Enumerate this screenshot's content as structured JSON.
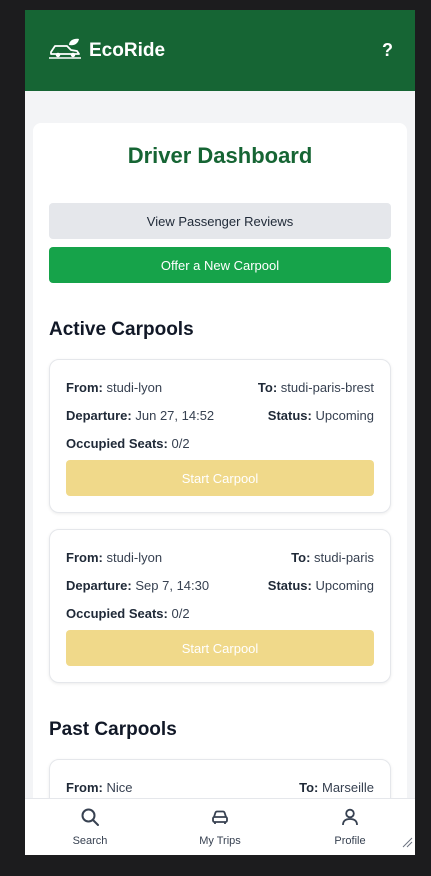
{
  "header": {
    "brand": "EcoRide",
    "help": "?"
  },
  "main": {
    "title": "Driver Dashboard",
    "reviews_label": "View Passenger Reviews",
    "offer_label": "Offer a New Carpool"
  },
  "active": {
    "title": "Active Carpools",
    "trips": [
      {
        "from_label": "From:",
        "from": "studi-lyon",
        "to_label": "To:",
        "to": "studi-paris-brest",
        "departure_label": "Departure:",
        "departure": "Jun 27, 14:52",
        "status_label": "Status:",
        "status": "Upcoming",
        "seats_label": "Occupied Seats:",
        "seats": "0/2",
        "action": "Start Carpool"
      },
      {
        "from_label": "From:",
        "from": "studi-lyon",
        "to_label": "To:",
        "to": "studi-paris",
        "departure_label": "Departure:",
        "departure": "Sep 7, 14:30",
        "status_label": "Status:",
        "status": "Upcoming",
        "seats_label": "Occupied Seats:",
        "seats": "0/2",
        "action": "Start Carpool"
      }
    ]
  },
  "past": {
    "title": "Past Carpools",
    "trips": [
      {
        "from_label": "From:",
        "from": "Nice",
        "to_label": "To:",
        "to": "Marseille"
      }
    ]
  },
  "nav": {
    "search": "Search",
    "trips": "My Trips",
    "profile": "Profile"
  },
  "colors": {
    "brand": "#166534",
    "accent": "#16a34a",
    "start_button": "#f0d98a"
  },
  "icons": {
    "brand": "car-leaf-icon",
    "search": "search-icon",
    "trips": "car-icon",
    "profile": "user-icon"
  }
}
